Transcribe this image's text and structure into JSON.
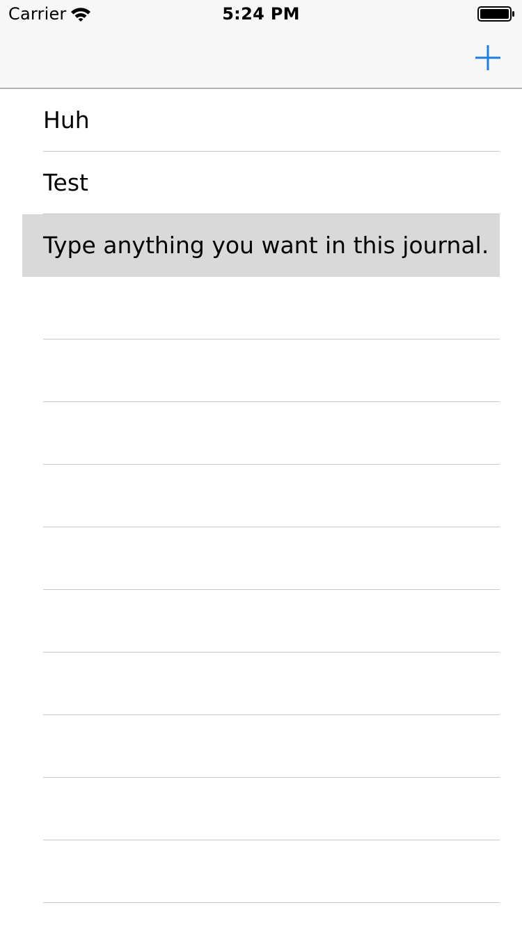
{
  "status_bar": {
    "carrier": "Carrier",
    "time": "5:24 PM",
    "wifi_icon": "wifi-icon",
    "battery_icon": "battery-icon"
  },
  "nav_bar": {
    "add_icon": "plus-icon",
    "accent_color": "#1a7fe0"
  },
  "entries": [
    {
      "title": "Huh"
    },
    {
      "title": "Test"
    },
    {
      "title": "Type anything you want in this journal.",
      "selected": true
    }
  ],
  "colors": {
    "navbar_bg": "#f7f7f7",
    "selected_row_bg": "#d9d9d9",
    "separator": "#c8c7cc"
  }
}
